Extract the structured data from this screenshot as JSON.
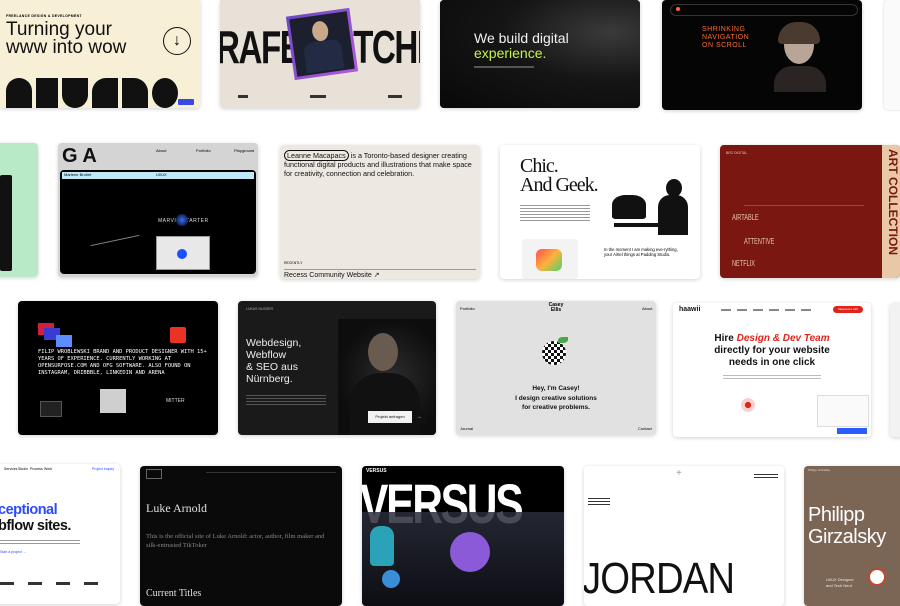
{
  "cards": {
    "turning": {
      "eyebrow": "FREELANCE DESIGN & DEVELOPMENT",
      "line1": "Turning your",
      "line2": "www into wow",
      "bg": "#f7efd6"
    },
    "rafe": {
      "title": "RAFE BUTCHEL",
      "bg": "#e8e1d7"
    },
    "build": {
      "line1": "We build digital",
      "line2": "experience.",
      "accent": "#c6f24e"
    },
    "shrinking": {
      "line1": "SHRINKING",
      "line2": "NAVIGATION",
      "line3": "ON SCROLL",
      "accent": "#ff6a2a"
    },
    "ga": {
      "logo": "G A",
      "nav": [
        "About",
        "Portfolio",
        "Playground"
      ],
      "name": "Marlene Brohet",
      "status": "UI/UX",
      "overlay": "MARVIN STARTER"
    },
    "leanne": {
      "name": "Leanne Macapacs",
      "intro": "is a Toronto-based designer creating functional digital products and illustrations that make space for creativity, connection and celebration.",
      "section": "RECENTLY",
      "link": "Recess Community Website ↗"
    },
    "chic": {
      "line1": "Chic.",
      "line2": "And Geek.",
      "caption": "In the moment I am making eve-rything, your Airtel things at Padding Studio."
    },
    "red": {
      "label": "BRZ DIGITAL",
      "side": "ART COLLECTION",
      "items": [
        "AIRTABLE",
        "ATTENTIVE",
        "NETFLIX"
      ]
    },
    "filip": {
      "text": "FILIP WROBLEWSKI BRAND AND PRODUCT DESIGNER WITH 15+ YEARS OF EXPERIENCE. CURRENTLY WORKING AT OPENSURFOSE.COM AND OFG SOFTWARE. ALSO FOUND ON INSTAGRAM, DRIBBBLE, LINKEDIN AND ARENA",
      "label": "MITTER"
    },
    "webdesign": {
      "nav_label": "LUKAS NUSSER",
      "lines": [
        "Webdesign,",
        "Webflow",
        "& SEO aus",
        "Nürnberg."
      ],
      "cta": "Projekt anfragen"
    },
    "casey": {
      "logo": "Casey Ellis",
      "nav_left": "Portfolio",
      "nav_right": "About",
      "greet": "Hey, I'm Casey!",
      "tag1": "I design creative solutions",
      "tag2": "for creative problems.",
      "foot_left": "Journal",
      "foot_right": "Contact"
    },
    "haawii": {
      "logo": "haawii",
      "cta": "Request a call",
      "line1a": "Hire ",
      "line1b": "Design & Dev Team",
      "line2": "directly for your website",
      "line3": "needs in one click",
      "accent": "#e2231a"
    },
    "exceptional": {
      "line1": "ceptional",
      "line2": "bflow sites.",
      "link": "Start a project →",
      "nav": [
        "Services",
        "Studio",
        "Process",
        "Work"
      ],
      "nav_btn": "Project inquiry"
    },
    "luke": {
      "name": "Luke Arnold",
      "bio": "This is the official site of Luke Arnold: actor, author, film maker and silk-entrusted TikToker",
      "section": "Current Titles"
    },
    "versus": {
      "label": "VERSUS",
      "title": "VERSUS"
    },
    "jordan": {
      "title": "JORDAN"
    },
    "philipp": {
      "nav": "Philipp Girzalsky",
      "line1": "Philipp",
      "line2": "Girzalsky",
      "role1": "UI/UX Designer",
      "role2": "and Tech Nerd",
      "bg": "#7b6555"
    }
  }
}
